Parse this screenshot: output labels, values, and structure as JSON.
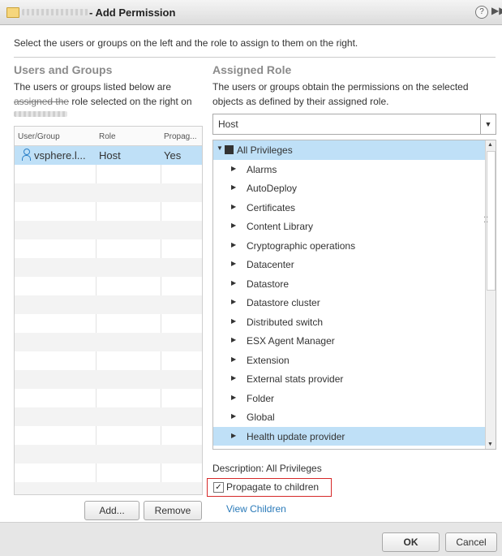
{
  "dialog": {
    "title": "- Add Permission",
    "help_icon": "?",
    "next_icon": "▶▶",
    "instruction": "Select the users or groups on the left and the role to assign to them on the right."
  },
  "users_groups": {
    "heading": "Users and Groups",
    "description_line1": "The users or groups listed below are",
    "description_line2_struck": "assigned the",
    "description_line2_rest": " role selected on the right on",
    "columns": [
      "User/Group",
      "Role",
      "Propag..."
    ],
    "rows": [
      {
        "user": "vsphere.l...",
        "role": "Host",
        "propagate": "Yes",
        "icon": "user-icon"
      }
    ],
    "add_button": "Add...",
    "remove_button": "Remove"
  },
  "assigned_role": {
    "heading": "Assigned Role",
    "description": "The users or groups obtain the permissions on the selected objects as defined by their assigned role.",
    "selected_role": "Host",
    "tree_root": "All Privileges",
    "privileges": [
      "Alarms",
      "AutoDeploy",
      "Certificates",
      "Content Library",
      "Cryptographic operations",
      "Datacenter",
      "Datastore",
      "Datastore cluster",
      "Distributed switch",
      "ESX Agent Manager",
      "Extension",
      "External stats provider",
      "Folder",
      "Global",
      "Health update provider"
    ],
    "description_line": "Description:  All Privileges",
    "propagate_label": "Propagate to children",
    "propagate_checked": true,
    "view_children_link": "View Children"
  },
  "footer": {
    "ok_label": "OK",
    "cancel_label": "Cancel"
  },
  "colors": {
    "selection": "#bfe0f7",
    "link": "#2a7ab9",
    "highlight_border": "#d62828"
  }
}
